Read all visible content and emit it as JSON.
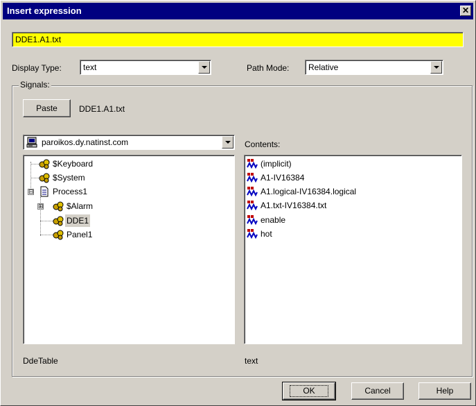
{
  "window": {
    "title": "Insert expression",
    "close_glyph": "✕"
  },
  "expression": {
    "value": "DDE1.A1.txt",
    "bg_color": "#ffff00"
  },
  "display_type": {
    "label": "Display Type:",
    "selected": "text"
  },
  "path_mode": {
    "label": "Path Mode:",
    "selected": "Relative"
  },
  "signals": {
    "group_label": "Signals:",
    "paste_label": "Paste",
    "paste_value": "DDE1.A1.txt",
    "server": "paroikos.dy.natinst.com",
    "contents_label": "Contents:",
    "tree": [
      {
        "label": "$Keyboard",
        "icon": "gear-cluster-icon"
      },
      {
        "label": "$System",
        "icon": "gear-cluster-icon"
      },
      {
        "label": "Process1",
        "icon": "document-icon",
        "expander": "⊟"
      },
      {
        "label": "$Alarm",
        "icon": "gear-cluster-icon",
        "expander": "⊞"
      },
      {
        "label": "DDE1",
        "icon": "gear-cluster-icon",
        "selected": true
      },
      {
        "label": "Panel1",
        "icon": "gear-cluster-icon"
      }
    ],
    "contents": [
      {
        "label": "(implicit)",
        "icon": "signal-wave-icon"
      },
      {
        "label": "A1-IV16384",
        "icon": "signal-wave-icon"
      },
      {
        "label": "A1.logical-IV16384.logical",
        "icon": "signal-wave-icon"
      },
      {
        "label": "A1.txt-IV16384.txt",
        "icon": "signal-wave-icon"
      },
      {
        "label": "enable",
        "icon": "signal-wave-icon"
      },
      {
        "label": "hot",
        "icon": "signal-wave-icon"
      }
    ],
    "tree_status": "DdeTable",
    "contents_status": "text"
  },
  "buttons": {
    "ok": "OK",
    "cancel": "Cancel",
    "help": "Help"
  }
}
